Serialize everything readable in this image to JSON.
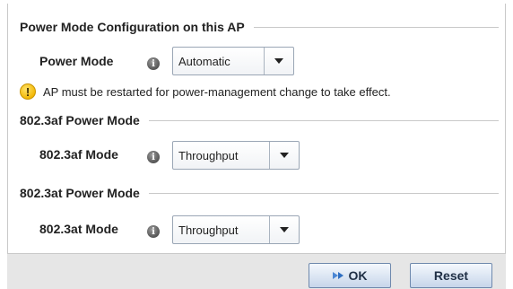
{
  "power_section": {
    "title": "Power Mode Configuration on this AP",
    "power_mode_label": "Power Mode",
    "power_mode_value": "Automatic",
    "warning_text": "AP must be restarted for power-management change to take effect."
  },
  "af_section": {
    "title": "802.3af Power Mode",
    "mode_label": "802.3af Mode",
    "mode_value": "Throughput"
  },
  "at_section": {
    "title": "802.3at Power Mode",
    "mode_label": "802.3at Mode",
    "mode_value": "Throughput"
  },
  "footer": {
    "ok_label": "OK",
    "reset_label": "Reset"
  },
  "icons": {
    "info": "info-icon",
    "warning": "warning-icon",
    "dropdown": "chevron-down-icon",
    "ok": "ok-arrow-icon"
  },
  "colors": {
    "button_border": "#6f89ad",
    "footer_bg": "#e6e6e6",
    "warning": "#f2b500"
  }
}
